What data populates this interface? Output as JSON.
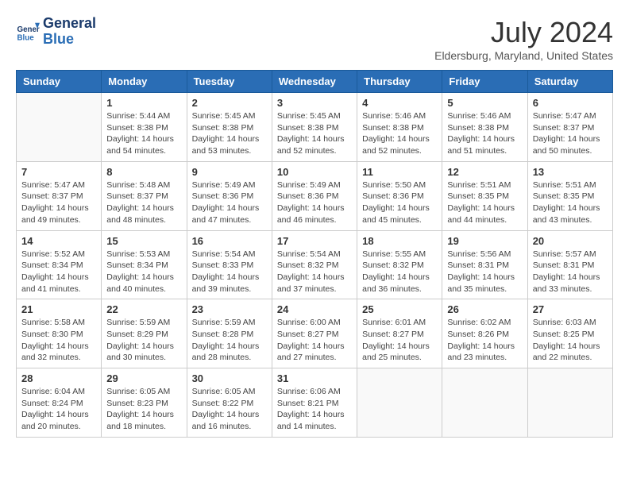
{
  "logo": {
    "text_general": "General",
    "text_blue": "Blue"
  },
  "title": {
    "month_year": "July 2024",
    "location": "Eldersburg, Maryland, United States"
  },
  "headers": [
    "Sunday",
    "Monday",
    "Tuesday",
    "Wednesday",
    "Thursday",
    "Friday",
    "Saturday"
  ],
  "weeks": [
    [
      {
        "day": "",
        "info": ""
      },
      {
        "day": "1",
        "info": "Sunrise: 5:44 AM\nSunset: 8:38 PM\nDaylight: 14 hours\nand 54 minutes."
      },
      {
        "day": "2",
        "info": "Sunrise: 5:45 AM\nSunset: 8:38 PM\nDaylight: 14 hours\nand 53 minutes."
      },
      {
        "day": "3",
        "info": "Sunrise: 5:45 AM\nSunset: 8:38 PM\nDaylight: 14 hours\nand 52 minutes."
      },
      {
        "day": "4",
        "info": "Sunrise: 5:46 AM\nSunset: 8:38 PM\nDaylight: 14 hours\nand 52 minutes."
      },
      {
        "day": "5",
        "info": "Sunrise: 5:46 AM\nSunset: 8:38 PM\nDaylight: 14 hours\nand 51 minutes."
      },
      {
        "day": "6",
        "info": "Sunrise: 5:47 AM\nSunset: 8:37 PM\nDaylight: 14 hours\nand 50 minutes."
      }
    ],
    [
      {
        "day": "7",
        "info": "Sunrise: 5:47 AM\nSunset: 8:37 PM\nDaylight: 14 hours\nand 49 minutes."
      },
      {
        "day": "8",
        "info": "Sunrise: 5:48 AM\nSunset: 8:37 PM\nDaylight: 14 hours\nand 48 minutes."
      },
      {
        "day": "9",
        "info": "Sunrise: 5:49 AM\nSunset: 8:36 PM\nDaylight: 14 hours\nand 47 minutes."
      },
      {
        "day": "10",
        "info": "Sunrise: 5:49 AM\nSunset: 8:36 PM\nDaylight: 14 hours\nand 46 minutes."
      },
      {
        "day": "11",
        "info": "Sunrise: 5:50 AM\nSunset: 8:36 PM\nDaylight: 14 hours\nand 45 minutes."
      },
      {
        "day": "12",
        "info": "Sunrise: 5:51 AM\nSunset: 8:35 PM\nDaylight: 14 hours\nand 44 minutes."
      },
      {
        "day": "13",
        "info": "Sunrise: 5:51 AM\nSunset: 8:35 PM\nDaylight: 14 hours\nand 43 minutes."
      }
    ],
    [
      {
        "day": "14",
        "info": "Sunrise: 5:52 AM\nSunset: 8:34 PM\nDaylight: 14 hours\nand 41 minutes."
      },
      {
        "day": "15",
        "info": "Sunrise: 5:53 AM\nSunset: 8:34 PM\nDaylight: 14 hours\nand 40 minutes."
      },
      {
        "day": "16",
        "info": "Sunrise: 5:54 AM\nSunset: 8:33 PM\nDaylight: 14 hours\nand 39 minutes."
      },
      {
        "day": "17",
        "info": "Sunrise: 5:54 AM\nSunset: 8:32 PM\nDaylight: 14 hours\nand 37 minutes."
      },
      {
        "day": "18",
        "info": "Sunrise: 5:55 AM\nSunset: 8:32 PM\nDaylight: 14 hours\nand 36 minutes."
      },
      {
        "day": "19",
        "info": "Sunrise: 5:56 AM\nSunset: 8:31 PM\nDaylight: 14 hours\nand 35 minutes."
      },
      {
        "day": "20",
        "info": "Sunrise: 5:57 AM\nSunset: 8:31 PM\nDaylight: 14 hours\nand 33 minutes."
      }
    ],
    [
      {
        "day": "21",
        "info": "Sunrise: 5:58 AM\nSunset: 8:30 PM\nDaylight: 14 hours\nand 32 minutes."
      },
      {
        "day": "22",
        "info": "Sunrise: 5:59 AM\nSunset: 8:29 PM\nDaylight: 14 hours\nand 30 minutes."
      },
      {
        "day": "23",
        "info": "Sunrise: 5:59 AM\nSunset: 8:28 PM\nDaylight: 14 hours\nand 28 minutes."
      },
      {
        "day": "24",
        "info": "Sunrise: 6:00 AM\nSunset: 8:27 PM\nDaylight: 14 hours\nand 27 minutes."
      },
      {
        "day": "25",
        "info": "Sunrise: 6:01 AM\nSunset: 8:27 PM\nDaylight: 14 hours\nand 25 minutes."
      },
      {
        "day": "26",
        "info": "Sunrise: 6:02 AM\nSunset: 8:26 PM\nDaylight: 14 hours\nand 23 minutes."
      },
      {
        "day": "27",
        "info": "Sunrise: 6:03 AM\nSunset: 8:25 PM\nDaylight: 14 hours\nand 22 minutes."
      }
    ],
    [
      {
        "day": "28",
        "info": "Sunrise: 6:04 AM\nSunset: 8:24 PM\nDaylight: 14 hours\nand 20 minutes."
      },
      {
        "day": "29",
        "info": "Sunrise: 6:05 AM\nSunset: 8:23 PM\nDaylight: 14 hours\nand 18 minutes."
      },
      {
        "day": "30",
        "info": "Sunrise: 6:05 AM\nSunset: 8:22 PM\nDaylight: 14 hours\nand 16 minutes."
      },
      {
        "day": "31",
        "info": "Sunrise: 6:06 AM\nSunset: 8:21 PM\nDaylight: 14 hours\nand 14 minutes."
      },
      {
        "day": "",
        "info": ""
      },
      {
        "day": "",
        "info": ""
      },
      {
        "day": "",
        "info": ""
      }
    ]
  ]
}
